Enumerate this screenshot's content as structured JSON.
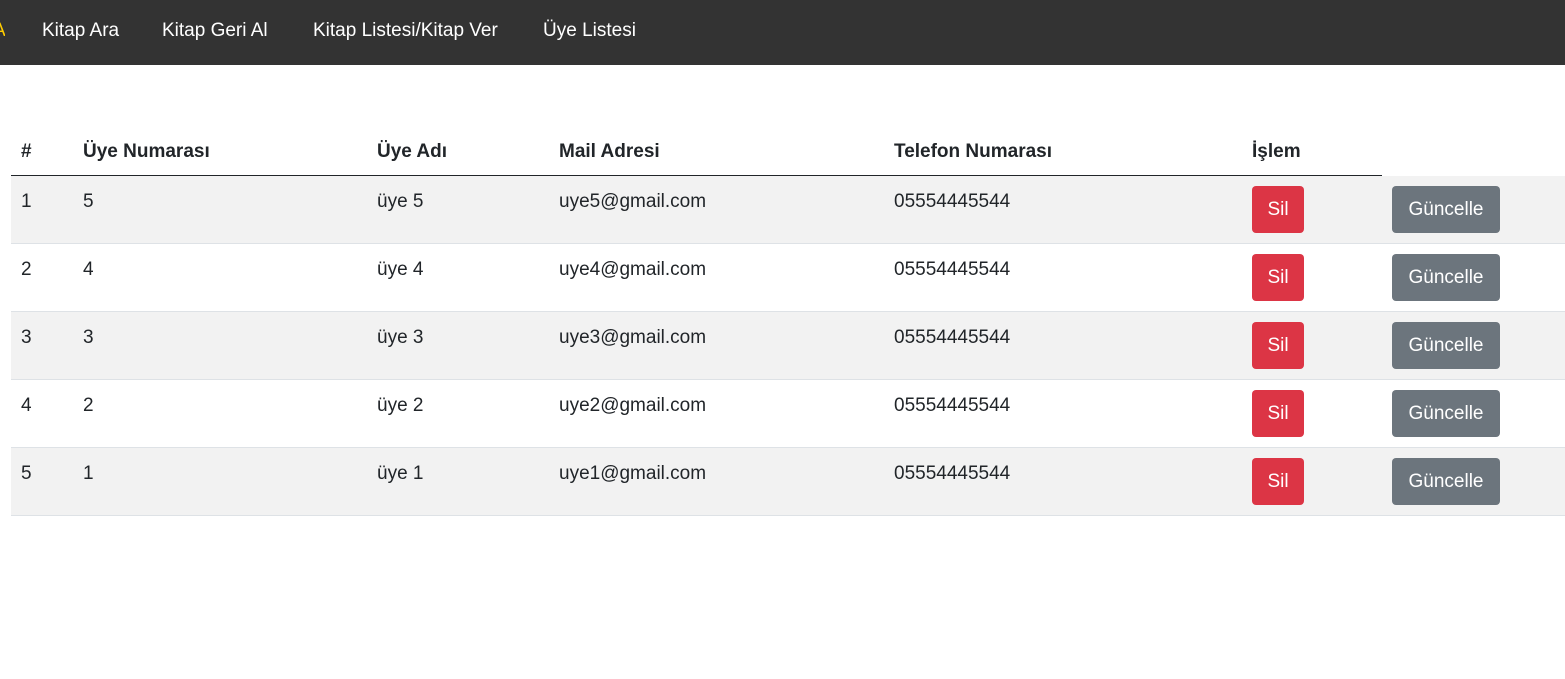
{
  "navbar": {
    "cut_item": "A",
    "items": [
      {
        "label": "Kitap Ara"
      },
      {
        "label": "Kitap Geri Al"
      },
      {
        "label": "Kitap Listesi/Kitap Ver"
      },
      {
        "label": "Üye Listesi"
      }
    ]
  },
  "table": {
    "headers": [
      "#",
      "Üye Numarası",
      "Üye Adı",
      "Mail Adresi",
      "Telefon Numarası",
      "İşlem"
    ],
    "rows": [
      {
        "index": "1",
        "member_no": "5",
        "name": "üye 5",
        "email": "uye5@gmail.com",
        "phone": "05554445544",
        "delete_label": "Sil",
        "update_label": "Güncelle"
      },
      {
        "index": "2",
        "member_no": "4",
        "name": "üye 4",
        "email": "uye4@gmail.com",
        "phone": "05554445544",
        "delete_label": "Sil",
        "update_label": "Güncelle"
      },
      {
        "index": "3",
        "member_no": "3",
        "name": "üye 3",
        "email": "uye3@gmail.com",
        "phone": "05554445544",
        "delete_label": "Sil",
        "update_label": "Güncelle"
      },
      {
        "index": "4",
        "member_no": "2",
        "name": "üye 2",
        "email": "uye2@gmail.com",
        "phone": "05554445544",
        "delete_label": "Sil",
        "update_label": "Güncelle"
      },
      {
        "index": "5",
        "member_no": "1",
        "name": "üye 1",
        "email": "uye1@gmail.com",
        "phone": "05554445544",
        "delete_label": "Sil",
        "update_label": "Güncelle"
      }
    ]
  },
  "colors": {
    "navbar_bg": "#333333",
    "danger": "#dc3545",
    "secondary": "#6c757d",
    "striped_row": "#f2f2f2"
  }
}
